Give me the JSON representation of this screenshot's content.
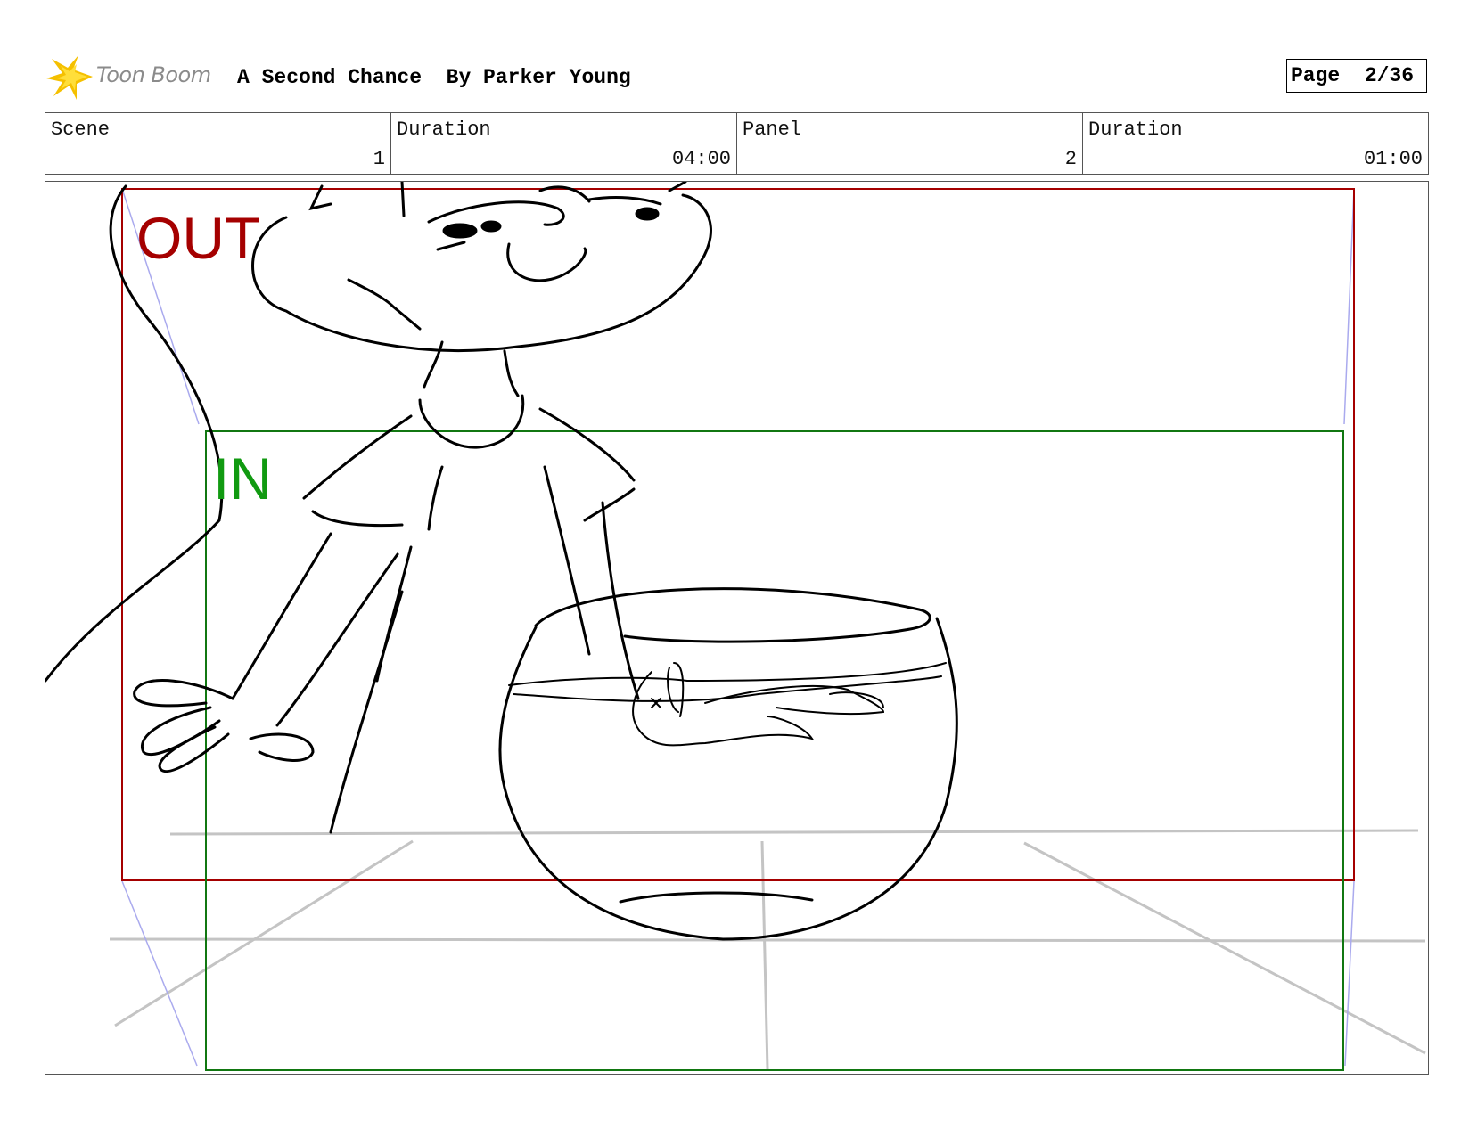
{
  "header": {
    "logo_text": "Toon Boom",
    "title": "A Second Chance  By Parker Young",
    "page": "Page  2/36"
  },
  "info": [
    {
      "label": "Scene",
      "value": "1"
    },
    {
      "label": "Duration",
      "value": "04:00"
    },
    {
      "label": "Panel",
      "value": "2"
    },
    {
      "label": "Duration",
      "value": "01:00"
    }
  ],
  "camera": {
    "out_label": "OUT",
    "in_label": "IN",
    "out_color": "#a50000",
    "in_color": "#119a11"
  },
  "colors": {
    "logo_star": "#f5c000",
    "perspective_lines": "#c4c4c4",
    "camera_move_guides": "#aaaaee"
  }
}
